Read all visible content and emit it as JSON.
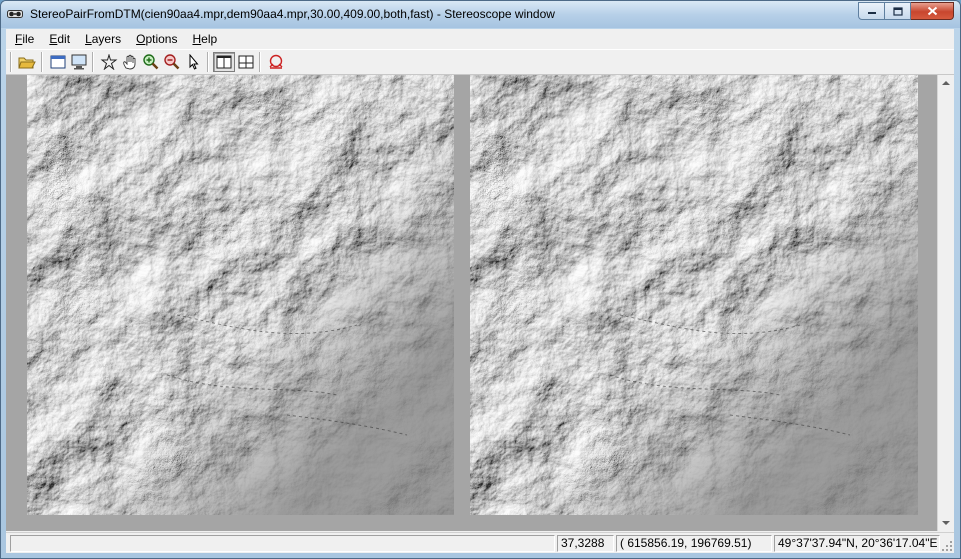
{
  "window": {
    "title": "StereoPairFromDTM(cien90aa4.mpr,dem90aa4.mpr,30.00,409.00,both,fast) - Stereoscope window",
    "icon": "stereo-glasses-icon",
    "caption_buttons": [
      "minimize-icon",
      "maximize-icon",
      "close-icon"
    ]
  },
  "menu": [
    {
      "id": "file",
      "accel": "F",
      "rest": "ile"
    },
    {
      "id": "edit",
      "accel": "E",
      "rest": "dit"
    },
    {
      "id": "layers",
      "accel": "L",
      "rest": "ayers"
    },
    {
      "id": "options",
      "accel": "O",
      "rest": "ptions"
    },
    {
      "id": "help",
      "accel": "H",
      "rest": "elp"
    }
  ],
  "toolbar": {
    "buttons": [
      {
        "name": "open-icon",
        "pressed": false
      },
      {
        "name": "page-icon",
        "pressed": false
      },
      {
        "name": "monitor-icon",
        "pressed": false
      },
      {
        "name": "entire-map-icon",
        "pressed": false
      },
      {
        "name": "pan-hand-icon",
        "pressed": false
      },
      {
        "name": "zoom-in-icon",
        "pressed": false
      },
      {
        "name": "zoom-out-icon",
        "pressed": false
      },
      {
        "name": "pointer-icon",
        "pressed": false
      },
      {
        "name": "single-view-icon",
        "pressed": true
      },
      {
        "name": "split-view-icon",
        "pressed": false
      },
      {
        "name": "stereo-glasses-icon",
        "pressed": false
      }
    ]
  },
  "panes": [
    {
      "name": "left-image",
      "content": "shaded-relief-dtm"
    },
    {
      "name": "right-image",
      "content": "shaded-relief-dtm"
    }
  ],
  "status": {
    "rowcol": "37,3288",
    "xy": "(   615856.19,   196769.51)",
    "latlon": "49°37'37.94\"N, 20°36'17.04\"E"
  },
  "colors": {
    "window_frame": "#a9c6e0",
    "background": "#f0f0f0",
    "view_background": "#a5a5a5",
    "relief_base": "#8a8a8a",
    "close_button": "#c8462f"
  }
}
